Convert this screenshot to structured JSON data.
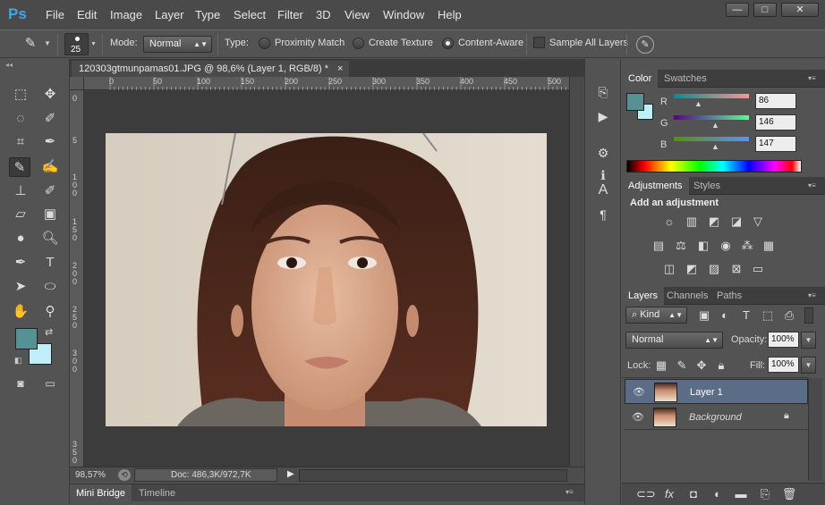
{
  "app": {
    "logo": "Ps"
  },
  "menu": [
    "File",
    "Edit",
    "Image",
    "Layer",
    "Type",
    "Select",
    "Filter",
    "3D",
    "View",
    "Window",
    "Help"
  ],
  "window_controls": {
    "minimize": "—",
    "maximize": "□",
    "close": "✕"
  },
  "options": {
    "brush_size": "25",
    "mode_label": "Mode:",
    "mode_value": "Normal",
    "type_label": "Type:",
    "type_options": [
      "Proximity Match",
      "Create Texture",
      "Content-Aware"
    ],
    "type_selected": "Content-Aware",
    "sample_all_layers": "Sample All Layers"
  },
  "document": {
    "tab_title": "120303gtmunpamas01.JPG @ 98,6% (Layer 1, RGB/8) *",
    "close": "×",
    "ruler_top": [
      "0",
      "50",
      "100",
      "150",
      "200",
      "250",
      "300",
      "350",
      "400",
      "450",
      "500"
    ],
    "ruler_left": [
      "0",
      "5",
      "1 0 0",
      "1 5 0",
      "2 0 0",
      "2 5 0",
      "3 0 0",
      "3 5 0"
    ],
    "zoom": "98,57%",
    "doc_info": "Doc: 486,3K/972,7K"
  },
  "bottom_tabs": [
    "Mini Bridge",
    "Timeline"
  ],
  "color_panel": {
    "tabs": [
      "Color",
      "Swatches"
    ],
    "channels": [
      {
        "label": "R",
        "value": "86"
      },
      {
        "label": "G",
        "value": "146"
      },
      {
        "label": "B",
        "value": "147"
      }
    ],
    "foreground": "#569293",
    "background": "#bfeef9"
  },
  "adjustments_panel": {
    "tabs": [
      "Adjustments",
      "Styles"
    ],
    "heading": "Add an adjustment"
  },
  "layers_panel": {
    "tabs": [
      "Layers",
      "Channels",
      "Paths"
    ],
    "kind_label": "Kind",
    "blend_mode": "Normal",
    "opacity_label": "Opacity:",
    "opacity_value": "100%",
    "lock_label": "Lock:",
    "fill_label": "Fill:",
    "fill_value": "100%",
    "layers": [
      {
        "name": "Layer 1",
        "selected": true
      },
      {
        "name": "Background",
        "selected": false,
        "locked": true
      }
    ]
  }
}
